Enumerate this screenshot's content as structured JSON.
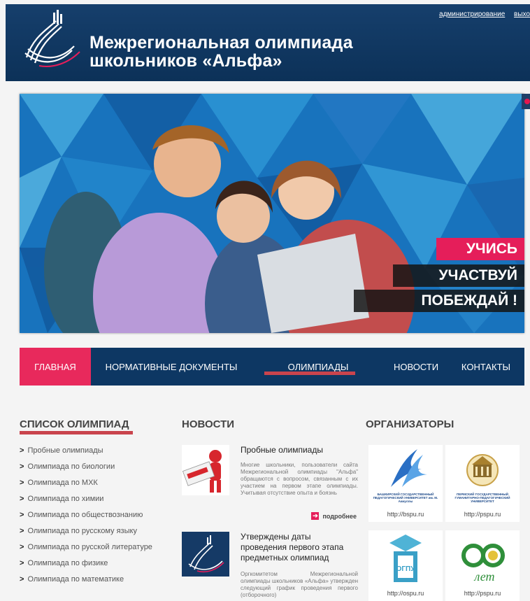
{
  "header": {
    "title_line1": "Межрегиональная олимпиада",
    "title_line2": "школьников «Альфа»",
    "admin_link": "администрирование",
    "exit_link": "выхо",
    "logo_icon": "alpha-logo-icon"
  },
  "banner": {
    "slogan1": "УЧИСЬ",
    "slogan2": "УЧАСТВУЙ",
    "slogan3": "ПОБЕЖДАЙ !",
    "accent": "#e51e5a"
  },
  "nav": {
    "items": [
      {
        "label": "ГЛАВНАЯ"
      },
      {
        "label": "НОРМАТИВНЫЕ ДОКУМЕНТЫ"
      },
      {
        "label": "ОЛИМПИАДЫ"
      },
      {
        "label": "НОВОСТИ"
      },
      {
        "label": "КОНТАКТЫ"
      }
    ],
    "active": "ГЛАВНАЯ",
    "bg": "#0d3763",
    "active_bg": "#e8295c"
  },
  "olympiads": {
    "title": "СПИСОК ОЛИМПИАД",
    "items": [
      "Пробные олимпиады",
      "Олимпиада по биологии",
      "Олимпиада по МХК",
      "Олимпиада по химии",
      "Олимпиада по обществознанию",
      "Олимпиада по русскому языку",
      "Олимпиада по русской литературе",
      "Олимпиада по физике",
      "Олимпиада по математике"
    ]
  },
  "news": {
    "title": "НОВОСТИ",
    "items": [
      {
        "title": "Пробные олимпиады",
        "text": "Многие школьники, пользователи сайта Межрегиональной олимпиады \"Альфа\" обращаются с вопросом, связанным с их участием на первом этапе олимпиады. Учитывая отсутствие опыта и боязнь",
        "more": "подробнее"
      },
      {
        "title": "Утверждены даты проведения первого этапа предметных олимпиад",
        "text": "Оргкомитетом Межрегиональной олимпиады школьников «Альфа» утвержден следующий график проведения первого (отборочного)"
      }
    ]
  },
  "organizers": {
    "title": "ОРГАНИЗАТОРЫ",
    "items": [
      {
        "caption": "БАШКИРСКИЙ ГОСУДАРСТВЕННЫЙ ПЕДАГОГИЧЕСКИЙ УНИВЕРСИТЕТ им. М. Акмуллы",
        "link": "http://bspu.ru"
      },
      {
        "caption": "ПЕРМСКИЙ ГОСУДАРСТВЕННЫЙ ГУМАНИТАРНО-ПЕДАГОГИЧЕСКИЙ УНИВЕРСИТЕТ",
        "link": "http://pspu.ru"
      },
      {
        "caption": "",
        "link": "http://ospu.ru"
      },
      {
        "caption": "",
        "link": "http://pspu.ru"
      }
    ],
    "ospu_label": "ОГПУ",
    "anniv_label": "лет"
  }
}
